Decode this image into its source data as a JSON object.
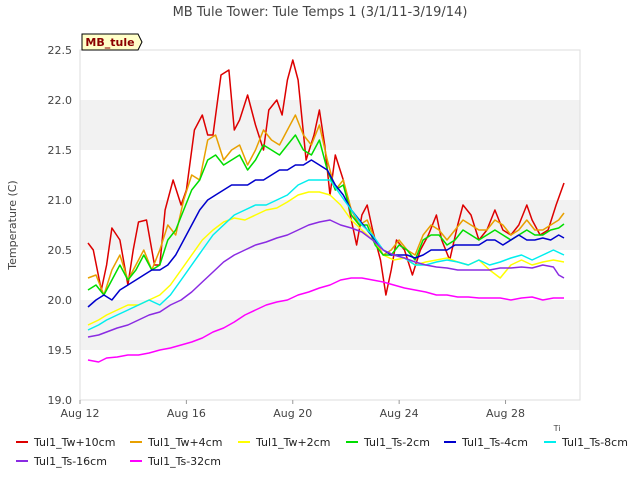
{
  "chart_data": {
    "type": "line",
    "title": "MB Tule Tower: Tule Temps 1 (3/1/11-3/19/14)",
    "xlabel": "",
    "ylabel": "Temperature (C)",
    "site_label": "MB_tule",
    "axis_corner_label": "Ti",
    "x_tick_labels": [
      "Aug 12",
      "Aug 16",
      "Aug 20",
      "Aug 24",
      "Aug 28"
    ],
    "x_tick_days": [
      12,
      16,
      20,
      24,
      28
    ],
    "xlim_days": [
      12,
      30.8
    ],
    "ylim": [
      19.0,
      22.5
    ],
    "y_ticks": [
      19.0,
      19.5,
      20.0,
      20.5,
      21.0,
      21.5,
      22.0,
      22.5
    ],
    "y_tick_labels": [
      "19.0",
      "19.5",
      "20.0",
      "20.5",
      "21.0",
      "21.5",
      "22.0",
      "22.5"
    ],
    "grid": "horizontal bands",
    "legend_position": "bottom",
    "series": [
      {
        "name": "Tul1_Tw+10cm",
        "color": "#dd0000",
        "x": [
          12.3,
          12.5,
          12.8,
          13.0,
          13.2,
          13.5,
          13.8,
          14.0,
          14.2,
          14.5,
          14.8,
          15.0,
          15.2,
          15.5,
          15.8,
          16.0,
          16.3,
          16.6,
          16.8,
          17.0,
          17.3,
          17.6,
          17.8,
          18.0,
          18.3,
          18.6,
          18.9,
          19.1,
          19.4,
          19.6,
          19.8,
          20.0,
          20.2,
          20.5,
          20.8,
          21.0,
          21.2,
          21.4,
          21.6,
          21.9,
          22.2,
          22.4,
          22.6,
          22.8,
          23.0,
          23.3,
          23.5,
          23.7,
          23.9,
          24.2,
          24.5,
          24.8,
          25.1,
          25.4,
          25.6,
          25.9,
          26.2,
          26.4,
          26.7,
          27.0,
          27.3,
          27.6,
          27.9,
          28.2,
          28.5,
          28.8,
          29.0,
          29.3,
          29.6,
          29.9,
          30.2
        ],
        "y": [
          20.57,
          20.5,
          20.1,
          20.35,
          20.72,
          20.6,
          20.15,
          20.5,
          20.78,
          20.8,
          20.35,
          20.35,
          20.9,
          21.2,
          20.95,
          21.1,
          21.7,
          21.85,
          21.65,
          21.65,
          22.25,
          22.3,
          21.7,
          21.8,
          22.05,
          21.75,
          21.5,
          21.9,
          22.0,
          21.85,
          22.2,
          22.4,
          22.2,
          21.4,
          21.65,
          21.9,
          21.55,
          21.05,
          21.45,
          21.2,
          20.8,
          20.55,
          20.85,
          20.95,
          20.7,
          20.4,
          20.05,
          20.3,
          20.6,
          20.5,
          20.25,
          20.5,
          20.65,
          20.85,
          20.6,
          20.4,
          20.75,
          20.95,
          20.85,
          20.6,
          20.7,
          20.9,
          20.7,
          20.65,
          20.75,
          20.95,
          20.8,
          20.65,
          20.7,
          20.95,
          21.17
        ]
      },
      {
        "name": "Tul1_Tw+4cm",
        "color": "#e8a000",
        "x": [
          12.3,
          12.6,
          12.9,
          13.2,
          13.5,
          13.8,
          14.1,
          14.4,
          14.7,
          15.0,
          15.3,
          15.6,
          15.9,
          16.2,
          16.5,
          16.8,
          17.1,
          17.4,
          17.7,
          18.0,
          18.3,
          18.6,
          18.9,
          19.2,
          19.5,
          19.8,
          20.1,
          20.4,
          20.7,
          21.0,
          21.3,
          21.6,
          21.9,
          22.2,
          22.5,
          22.8,
          23.1,
          23.4,
          23.7,
          24.0,
          24.3,
          24.6,
          24.9,
          25.2,
          25.5,
          25.8,
          26.1,
          26.4,
          26.7,
          27.0,
          27.3,
          27.6,
          27.9,
          28.2,
          28.5,
          28.8,
          29.1,
          29.4,
          29.7,
          30.0,
          30.2
        ],
        "y": [
          20.22,
          20.25,
          20.05,
          20.3,
          20.45,
          20.2,
          20.35,
          20.5,
          20.3,
          20.5,
          20.75,
          20.65,
          21.0,
          21.25,
          21.2,
          21.6,
          21.65,
          21.4,
          21.5,
          21.55,
          21.35,
          21.5,
          21.7,
          21.6,
          21.55,
          21.7,
          21.85,
          21.65,
          21.55,
          21.75,
          21.4,
          21.1,
          21.2,
          20.9,
          20.75,
          20.8,
          20.6,
          20.45,
          20.5,
          20.6,
          20.5,
          20.45,
          20.65,
          20.75,
          20.7,
          20.6,
          20.7,
          20.8,
          20.75,
          20.7,
          20.7,
          20.8,
          20.75,
          20.65,
          20.7,
          20.8,
          20.7,
          20.7,
          20.75,
          20.8,
          20.87
        ]
      },
      {
        "name": "Tul1_Tw+2cm",
        "color": "#ffff00",
        "x": [
          12.3,
          12.7,
          13.0,
          13.4,
          13.8,
          14.2,
          14.6,
          15.0,
          15.4,
          15.8,
          16.2,
          16.6,
          17.0,
          17.4,
          17.8,
          18.2,
          18.6,
          19.0,
          19.4,
          19.8,
          20.2,
          20.6,
          21.0,
          21.4,
          21.8,
          22.2,
          22.6,
          23.0,
          23.4,
          23.8,
          24.2,
          24.6,
          25.0,
          25.4,
          25.8,
          26.2,
          26.6,
          27.0,
          27.4,
          27.8,
          28.2,
          28.6,
          29.0,
          29.4,
          29.8,
          30.2
        ],
        "y": [
          19.75,
          19.8,
          19.85,
          19.9,
          19.95,
          19.95,
          20.0,
          20.05,
          20.15,
          20.3,
          20.45,
          20.6,
          20.7,
          20.78,
          20.82,
          20.8,
          20.85,
          20.9,
          20.92,
          20.98,
          21.05,
          21.08,
          21.08,
          21.05,
          20.95,
          20.8,
          20.7,
          20.6,
          20.45,
          20.4,
          20.42,
          20.35,
          20.38,
          20.4,
          20.42,
          20.38,
          20.35,
          20.4,
          20.3,
          20.22,
          20.35,
          20.4,
          20.35,
          20.38,
          20.4,
          20.38
        ]
      },
      {
        "name": "Tul1_Ts-2cm",
        "color": "#00dd00",
        "x": [
          12.3,
          12.6,
          12.9,
          13.2,
          13.5,
          13.8,
          14.1,
          14.4,
          14.7,
          15.0,
          15.3,
          15.6,
          15.9,
          16.2,
          16.5,
          16.8,
          17.1,
          17.4,
          17.7,
          18.0,
          18.3,
          18.6,
          18.9,
          19.2,
          19.5,
          19.8,
          20.1,
          20.4,
          20.7,
          21.0,
          21.3,
          21.6,
          21.9,
          22.2,
          22.5,
          22.8,
          23.1,
          23.4,
          23.7,
          24.0,
          24.3,
          24.6,
          24.9,
          25.2,
          25.5,
          25.8,
          26.1,
          26.4,
          26.7,
          27.0,
          27.3,
          27.6,
          27.9,
          28.2,
          28.5,
          28.8,
          29.1,
          29.4,
          29.7,
          30.0,
          30.2
        ],
        "y": [
          20.1,
          20.15,
          20.05,
          20.2,
          20.35,
          20.2,
          20.3,
          20.45,
          20.3,
          20.35,
          20.6,
          20.7,
          20.9,
          21.1,
          21.2,
          21.4,
          21.45,
          21.35,
          21.4,
          21.45,
          21.3,
          21.4,
          21.55,
          21.5,
          21.45,
          21.55,
          21.65,
          21.5,
          21.45,
          21.6,
          21.3,
          21.1,
          21.15,
          20.85,
          20.75,
          20.75,
          20.55,
          20.45,
          20.45,
          20.55,
          20.5,
          20.4,
          20.6,
          20.65,
          20.65,
          20.55,
          20.6,
          20.7,
          20.65,
          20.6,
          20.65,
          20.7,
          20.65,
          20.6,
          20.65,
          20.7,
          20.65,
          20.65,
          20.7,
          20.72,
          20.76
        ]
      },
      {
        "name": "Tul1_Ts-4cm",
        "color": "#0000cc",
        "x": [
          12.3,
          12.6,
          12.9,
          13.2,
          13.5,
          13.8,
          14.1,
          14.4,
          14.7,
          15.0,
          15.3,
          15.6,
          15.9,
          16.2,
          16.5,
          16.8,
          17.1,
          17.4,
          17.7,
          18.0,
          18.3,
          18.6,
          18.9,
          19.2,
          19.5,
          19.8,
          20.1,
          20.4,
          20.7,
          21.0,
          21.3,
          21.6,
          21.9,
          22.2,
          22.5,
          22.8,
          23.1,
          23.4,
          23.7,
          24.0,
          24.3,
          24.6,
          24.9,
          25.2,
          25.5,
          25.8,
          26.1,
          26.4,
          26.7,
          27.0,
          27.3,
          27.6,
          27.9,
          28.2,
          28.5,
          28.8,
          29.1,
          29.4,
          29.7,
          30.0,
          30.2
        ],
        "y": [
          19.93,
          20.0,
          20.05,
          20.0,
          20.1,
          20.15,
          20.2,
          20.25,
          20.3,
          20.3,
          20.35,
          20.45,
          20.6,
          20.75,
          20.9,
          21.0,
          21.05,
          21.1,
          21.15,
          21.15,
          21.15,
          21.2,
          21.2,
          21.25,
          21.3,
          21.3,
          21.35,
          21.35,
          21.4,
          21.35,
          21.3,
          21.15,
          21.05,
          20.9,
          20.8,
          20.7,
          20.6,
          20.5,
          20.45,
          20.45,
          20.45,
          20.42,
          20.45,
          20.5,
          20.5,
          20.5,
          20.55,
          20.55,
          20.55,
          20.55,
          20.6,
          20.6,
          20.55,
          20.6,
          20.65,
          20.6,
          20.6,
          20.62,
          20.6,
          20.65,
          20.62
        ]
      },
      {
        "name": "Tul1_Ts-8cm",
        "color": "#00eeee",
        "x": [
          12.3,
          12.7,
          13.0,
          13.4,
          13.8,
          14.2,
          14.6,
          15.0,
          15.4,
          15.8,
          16.2,
          16.6,
          17.0,
          17.4,
          17.8,
          18.2,
          18.6,
          19.0,
          19.4,
          19.8,
          20.2,
          20.6,
          21.0,
          21.4,
          21.8,
          22.2,
          22.6,
          23.0,
          23.4,
          23.8,
          24.2,
          24.6,
          25.0,
          25.4,
          25.8,
          26.2,
          26.6,
          27.0,
          27.4,
          27.8,
          28.2,
          28.6,
          29.0,
          29.4,
          29.8,
          30.2
        ],
        "y": [
          19.7,
          19.75,
          19.8,
          19.85,
          19.9,
          19.95,
          20.0,
          19.95,
          20.05,
          20.2,
          20.35,
          20.5,
          20.65,
          20.75,
          20.85,
          20.9,
          20.95,
          20.95,
          21.0,
          21.05,
          21.15,
          21.2,
          21.2,
          21.2,
          21.05,
          20.9,
          20.75,
          20.65,
          20.5,
          20.45,
          20.42,
          20.35,
          20.35,
          20.38,
          20.4,
          20.38,
          20.35,
          20.4,
          20.35,
          20.38,
          20.42,
          20.45,
          20.4,
          20.45,
          20.5,
          20.45
        ]
      },
      {
        "name": "Tul1_Ts-16cm",
        "color": "#8a2be2",
        "x": [
          12.3,
          12.7,
          13.0,
          13.4,
          13.8,
          14.2,
          14.6,
          15.0,
          15.4,
          15.8,
          16.2,
          16.6,
          17.0,
          17.4,
          17.8,
          18.2,
          18.6,
          19.0,
          19.4,
          19.8,
          20.2,
          20.6,
          21.0,
          21.4,
          21.8,
          22.2,
          22.6,
          23.0,
          23.4,
          23.8,
          24.2,
          24.6,
          25.0,
          25.4,
          25.8,
          26.2,
          26.6,
          27.0,
          27.4,
          27.8,
          28.2,
          28.6,
          29.0,
          29.4,
          29.8,
          30.0,
          30.2
        ],
        "y": [
          19.63,
          19.65,
          19.68,
          19.72,
          19.75,
          19.8,
          19.85,
          19.88,
          19.95,
          20.0,
          20.08,
          20.18,
          20.28,
          20.38,
          20.45,
          20.5,
          20.55,
          20.58,
          20.62,
          20.65,
          20.7,
          20.75,
          20.78,
          20.8,
          20.75,
          20.72,
          20.68,
          20.6,
          20.5,
          20.45,
          20.42,
          20.38,
          20.35,
          20.33,
          20.32,
          20.3,
          20.3,
          20.3,
          20.3,
          20.32,
          20.32,
          20.33,
          20.32,
          20.35,
          20.33,
          20.25,
          20.22
        ]
      },
      {
        "name": "Tul1_Ts-32cm",
        "color": "#ff00ff",
        "x": [
          12.3,
          12.7,
          13.0,
          13.4,
          13.8,
          14.2,
          14.6,
          15.0,
          15.4,
          15.8,
          16.2,
          16.6,
          17.0,
          17.4,
          17.8,
          18.2,
          18.6,
          19.0,
          19.4,
          19.8,
          20.2,
          20.6,
          21.0,
          21.4,
          21.8,
          22.2,
          22.6,
          23.0,
          23.4,
          23.8,
          24.2,
          24.6,
          25.0,
          25.4,
          25.8,
          26.2,
          26.6,
          27.0,
          27.4,
          27.8,
          28.2,
          28.6,
          29.0,
          29.4,
          29.8,
          30.2
        ],
        "y": [
          19.4,
          19.38,
          19.42,
          19.43,
          19.45,
          19.45,
          19.47,
          19.5,
          19.52,
          19.55,
          19.58,
          19.62,
          19.68,
          19.72,
          19.78,
          19.85,
          19.9,
          19.95,
          19.98,
          20.0,
          20.05,
          20.08,
          20.12,
          20.15,
          20.2,
          20.22,
          20.22,
          20.2,
          20.18,
          20.15,
          20.12,
          20.1,
          20.08,
          20.05,
          20.05,
          20.03,
          20.03,
          20.02,
          20.02,
          20.02,
          20.0,
          20.02,
          20.03,
          20.0,
          20.02,
          20.02
        ]
      }
    ]
  }
}
